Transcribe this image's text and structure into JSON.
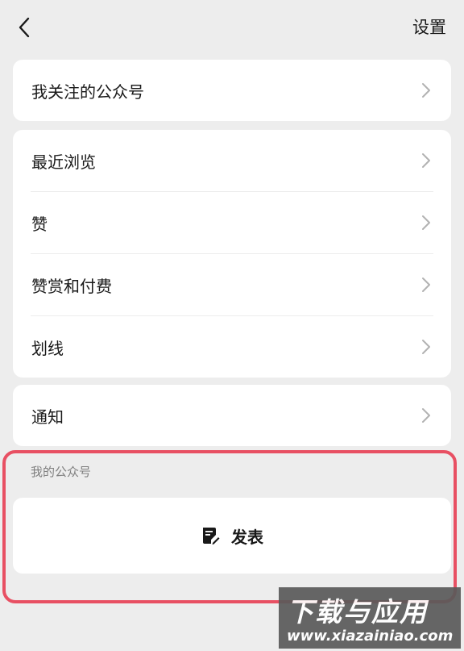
{
  "header": {
    "settings_label": "设置"
  },
  "groups": [
    {
      "items": [
        {
          "label": "我关注的公众号"
        }
      ]
    },
    {
      "items": [
        {
          "label": "最近浏览"
        },
        {
          "label": "赞"
        },
        {
          "label": "赞赏和付费"
        },
        {
          "label": "划线"
        }
      ]
    },
    {
      "items": [
        {
          "label": "通知"
        }
      ]
    }
  ],
  "my_account": {
    "section_label": "我的公众号",
    "publish_label": "发表"
  },
  "highlight_color": "#e85063",
  "watermark": {
    "title": "下载与应用",
    "url": "www.xiazainiao.com"
  }
}
